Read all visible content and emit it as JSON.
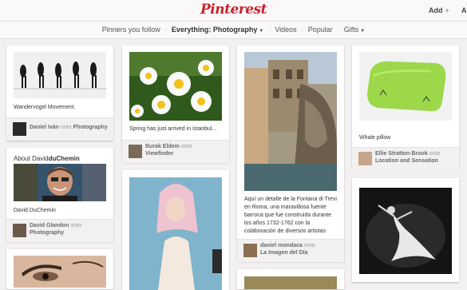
{
  "header": {
    "logo": "Pinterest",
    "add_label": "Add",
    "add_icon": "+",
    "account_initial": "A"
  },
  "subnav": {
    "pinners": "Pinners you follow",
    "everything": "Everything: Photography",
    "videos": "Videos",
    "popular": "Popular",
    "gifts": "Gifts",
    "sep": "·",
    "caret": "▼"
  },
  "pins": [
    {
      "description": "Wandervogel Movement.",
      "pinner": "Daniel Iván",
      "onto": "onto",
      "board": "Photography"
    },
    {
      "about_prefix": "About David",
      "about_name": "duChemin",
      "description": "David DuChemin",
      "pinner": "David Glandon",
      "onto": "onto",
      "board": "Photography"
    },
    {
      "description": "Spring has just arrived in Istanbul...",
      "pinner": "Burak Eldem",
      "onto": "onto",
      "board": "Viewfinder"
    },
    {
      "description": "Aquí un detalle de la Fontana di Trevi en Roma, una maravillosa fuente barroca que fue construida durante los años 1732-1762 con la colaboración de diversos artistas",
      "pinner": "daniel mondaca",
      "onto": "onto",
      "board": "La Imagen del Día"
    },
    {
      "description": "Whale pillow",
      "pinner": "Ellie Stratton-Brook",
      "onto": "onto",
      "board": "Location and Sensation"
    }
  ]
}
